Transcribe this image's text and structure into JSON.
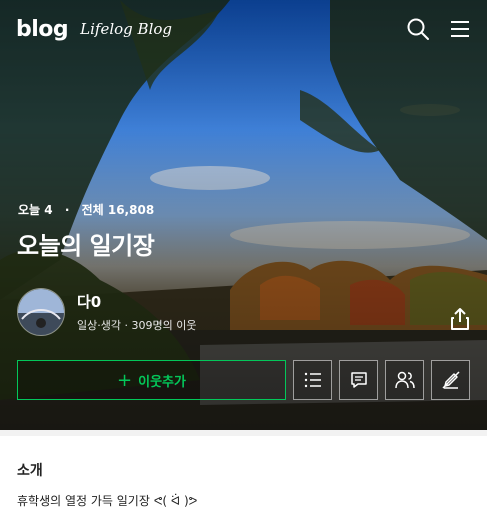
{
  "header": {
    "logo": "blog",
    "logo_sub": "Lifelog Blog",
    "icons": [
      "search-icon",
      "menu-icon"
    ]
  },
  "stats": {
    "today_label": "오늘",
    "today_value": "4",
    "total_label": "전체",
    "total_value": "16,808"
  },
  "blog": {
    "title": "오늘의 일기장"
  },
  "profile": {
    "name": "다0",
    "meta": "일상·생각 · 309명의 이웃"
  },
  "actions": {
    "follow_label": "이웃추가",
    "icons": [
      "list-icon",
      "comment-icon",
      "neighbors-icon",
      "edit-off-icon"
    ],
    "accent_color": "#03c75a"
  },
  "intro": {
    "title": "소개",
    "text": "휴학생의 열정 가득 일기장 ᕙ( ᐛ )ᕗ"
  }
}
